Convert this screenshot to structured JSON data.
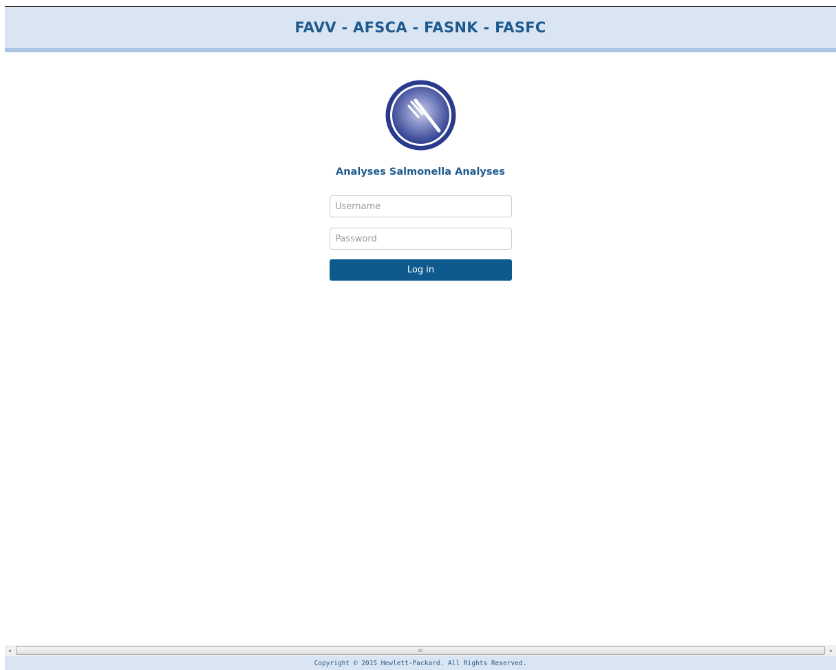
{
  "header": {
    "title": "FAVV - AFSCA - FASNK - FASFC"
  },
  "logo": {
    "icon": "test-tube-icon",
    "colors": {
      "outer": "#2a3a8c",
      "inner": "#8a95c9",
      "highlight": "#ffffff"
    }
  },
  "login": {
    "app_title": "Analyses Salmonella Analyses",
    "username_placeholder": "Username",
    "password_placeholder": "Password",
    "username_value": "",
    "password_value": "",
    "submit_label": "Log in"
  },
  "scrollbar": {
    "left_arrow": "◂",
    "right_arrow": "▸",
    "grip": "III"
  },
  "footer": {
    "copyright": "Copyright © 2015 Hewlett-Packard. All Rights Reserved."
  },
  "theme": {
    "accent": "#1f5a8e",
    "button": "#0e5a8f",
    "header_bg": "#d9e5f3",
    "header_border": "#a9c7e4"
  }
}
